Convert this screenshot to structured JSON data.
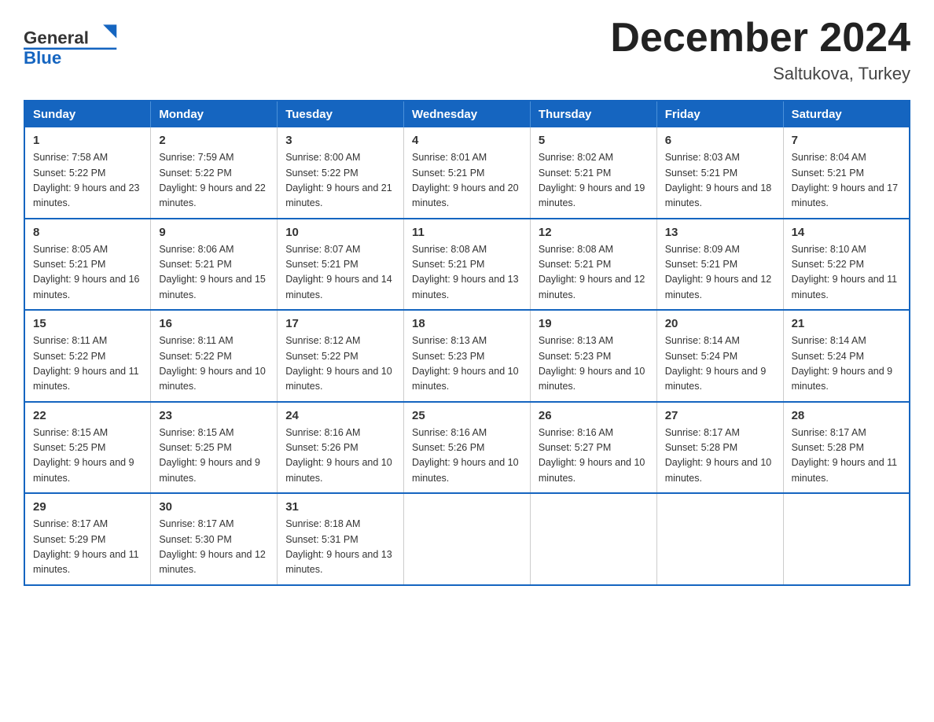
{
  "header": {
    "logo_general": "General",
    "logo_blue": "Blue",
    "month_title": "December 2024",
    "location": "Saltukova, Turkey"
  },
  "days_of_week": [
    "Sunday",
    "Monday",
    "Tuesday",
    "Wednesday",
    "Thursday",
    "Friday",
    "Saturday"
  ],
  "weeks": [
    [
      {
        "day": "1",
        "sunrise": "7:58 AM",
        "sunset": "5:22 PM",
        "daylight": "9 hours and 23 minutes."
      },
      {
        "day": "2",
        "sunrise": "7:59 AM",
        "sunset": "5:22 PM",
        "daylight": "9 hours and 22 minutes."
      },
      {
        "day": "3",
        "sunrise": "8:00 AM",
        "sunset": "5:22 PM",
        "daylight": "9 hours and 21 minutes."
      },
      {
        "day": "4",
        "sunrise": "8:01 AM",
        "sunset": "5:21 PM",
        "daylight": "9 hours and 20 minutes."
      },
      {
        "day": "5",
        "sunrise": "8:02 AM",
        "sunset": "5:21 PM",
        "daylight": "9 hours and 19 minutes."
      },
      {
        "day": "6",
        "sunrise": "8:03 AM",
        "sunset": "5:21 PM",
        "daylight": "9 hours and 18 minutes."
      },
      {
        "day": "7",
        "sunrise": "8:04 AM",
        "sunset": "5:21 PM",
        "daylight": "9 hours and 17 minutes."
      }
    ],
    [
      {
        "day": "8",
        "sunrise": "8:05 AM",
        "sunset": "5:21 PM",
        "daylight": "9 hours and 16 minutes."
      },
      {
        "day": "9",
        "sunrise": "8:06 AM",
        "sunset": "5:21 PM",
        "daylight": "9 hours and 15 minutes."
      },
      {
        "day": "10",
        "sunrise": "8:07 AM",
        "sunset": "5:21 PM",
        "daylight": "9 hours and 14 minutes."
      },
      {
        "day": "11",
        "sunrise": "8:08 AM",
        "sunset": "5:21 PM",
        "daylight": "9 hours and 13 minutes."
      },
      {
        "day": "12",
        "sunrise": "8:08 AM",
        "sunset": "5:21 PM",
        "daylight": "9 hours and 12 minutes."
      },
      {
        "day": "13",
        "sunrise": "8:09 AM",
        "sunset": "5:21 PM",
        "daylight": "9 hours and 12 minutes."
      },
      {
        "day": "14",
        "sunrise": "8:10 AM",
        "sunset": "5:22 PM",
        "daylight": "9 hours and 11 minutes."
      }
    ],
    [
      {
        "day": "15",
        "sunrise": "8:11 AM",
        "sunset": "5:22 PM",
        "daylight": "9 hours and 11 minutes."
      },
      {
        "day": "16",
        "sunrise": "8:11 AM",
        "sunset": "5:22 PM",
        "daylight": "9 hours and 10 minutes."
      },
      {
        "day": "17",
        "sunrise": "8:12 AM",
        "sunset": "5:22 PM",
        "daylight": "9 hours and 10 minutes."
      },
      {
        "day": "18",
        "sunrise": "8:13 AM",
        "sunset": "5:23 PM",
        "daylight": "9 hours and 10 minutes."
      },
      {
        "day": "19",
        "sunrise": "8:13 AM",
        "sunset": "5:23 PM",
        "daylight": "9 hours and 10 minutes."
      },
      {
        "day": "20",
        "sunrise": "8:14 AM",
        "sunset": "5:24 PM",
        "daylight": "9 hours and 9 minutes."
      },
      {
        "day": "21",
        "sunrise": "8:14 AM",
        "sunset": "5:24 PM",
        "daylight": "9 hours and 9 minutes."
      }
    ],
    [
      {
        "day": "22",
        "sunrise": "8:15 AM",
        "sunset": "5:25 PM",
        "daylight": "9 hours and 9 minutes."
      },
      {
        "day": "23",
        "sunrise": "8:15 AM",
        "sunset": "5:25 PM",
        "daylight": "9 hours and 9 minutes."
      },
      {
        "day": "24",
        "sunrise": "8:16 AM",
        "sunset": "5:26 PM",
        "daylight": "9 hours and 10 minutes."
      },
      {
        "day": "25",
        "sunrise": "8:16 AM",
        "sunset": "5:26 PM",
        "daylight": "9 hours and 10 minutes."
      },
      {
        "day": "26",
        "sunrise": "8:16 AM",
        "sunset": "5:27 PM",
        "daylight": "9 hours and 10 minutes."
      },
      {
        "day": "27",
        "sunrise": "8:17 AM",
        "sunset": "5:28 PM",
        "daylight": "9 hours and 10 minutes."
      },
      {
        "day": "28",
        "sunrise": "8:17 AM",
        "sunset": "5:28 PM",
        "daylight": "9 hours and 11 minutes."
      }
    ],
    [
      {
        "day": "29",
        "sunrise": "8:17 AM",
        "sunset": "5:29 PM",
        "daylight": "9 hours and 11 minutes."
      },
      {
        "day": "30",
        "sunrise": "8:17 AM",
        "sunset": "5:30 PM",
        "daylight": "9 hours and 12 minutes."
      },
      {
        "day": "31",
        "sunrise": "8:18 AM",
        "sunset": "5:31 PM",
        "daylight": "9 hours and 13 minutes."
      },
      null,
      null,
      null,
      null
    ]
  ],
  "labels": {
    "sunrise_prefix": "Sunrise: ",
    "sunset_prefix": "Sunset: ",
    "daylight_prefix": "Daylight: "
  }
}
